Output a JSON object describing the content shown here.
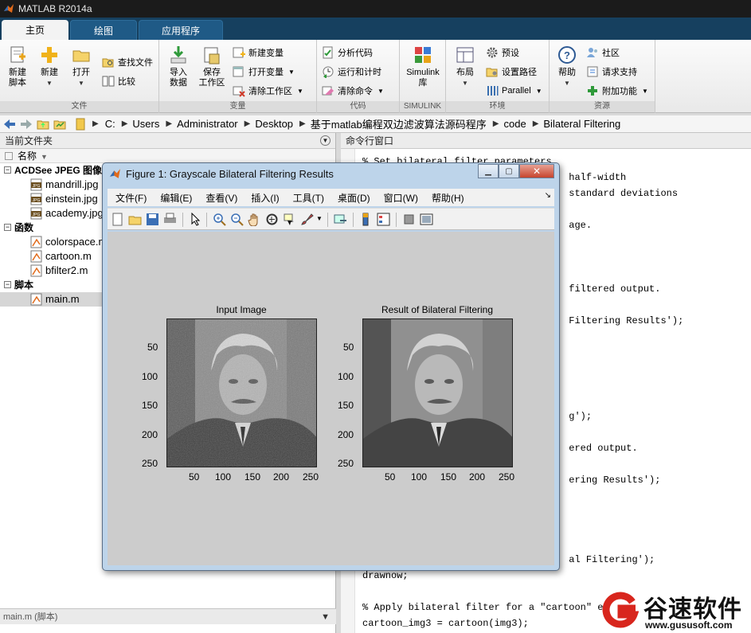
{
  "window": {
    "title": "MATLAB R2014a"
  },
  "tabs": [
    {
      "label": "主页",
      "active": true
    },
    {
      "label": "绘图",
      "active": false
    },
    {
      "label": "应用程序",
      "active": false
    }
  ],
  "ribbon": {
    "file_group": {
      "label": "文件",
      "new_script": "新建\n脚本",
      "new": "新建",
      "open": "打开",
      "find_files": "查找文件",
      "compare": "比较"
    },
    "variable_group": {
      "label": "变量",
      "import_data": "导入\n数据",
      "save_workspace": "保存\n工作区",
      "new_variable": "新建变量",
      "open_variable": "打开变量",
      "clear_workspace": "清除工作区"
    },
    "code_group": {
      "label": "代码",
      "analyze_code": "分析代码",
      "run_and_time": "运行和计时",
      "clear_commands": "清除命令"
    },
    "simulink_group": {
      "label": "SIMULINK",
      "library": "Simulink\n库"
    },
    "environment_group": {
      "label": "环境",
      "layout": "布局",
      "preferences": "预设",
      "set_path": "设置路径",
      "parallel": "Parallel"
    },
    "resources_group": {
      "label": "资源",
      "help": "帮助",
      "community": "社区",
      "request_support": "请求支持",
      "add_ons": "附加功能"
    }
  },
  "address": {
    "crumbs": [
      "C:",
      "Users",
      "Administrator",
      "Desktop",
      "基于matlab编程双边滤波算法源码程序",
      "code",
      "Bilateral Filtering"
    ]
  },
  "current_folder": {
    "title": "当前文件夹",
    "column_name": "名称",
    "groups": [
      {
        "label": "ACDSee JPEG 图像",
        "items": [
          "mandrill.jpg",
          "einstein.jpg",
          "academy.jpg"
        ]
      },
      {
        "label": "函数",
        "items": [
          "colorspace.m",
          "cartoon.m",
          "bfilter2.m"
        ]
      },
      {
        "label": "脚本",
        "items": [
          "main.m"
        ]
      }
    ],
    "details_label": "main.m (脚本)"
  },
  "command_window": {
    "title": "命令行窗口",
    "lines": [
      "% Set bilateral filter parameters.",
      "                                    half-width",
      "                                    standard deviations",
      "",
      "                                    age.",
      "",
      "",
      "",
      "                                    filtered output.",
      "",
      "                                    Filtering Results');",
      "",
      "",
      "",
      "",
      "",
      "                                    g');",
      "",
      "                                    ered output.",
      "",
      "                                    ering Results');",
      "",
      "",
      "",
      "",
      "                                    al Filtering');",
      "drawnow;",
      "",
      "% Apply bilateral filter for a \"cartoon\" ef",
      "cartoon_img3 = cartoon(img3);"
    ]
  },
  "figure": {
    "title": "Figure 1: Grayscale Bilateral Filtering Results",
    "menu": [
      "文件(F)",
      "编辑(E)",
      "查看(V)",
      "插入(I)",
      "工具(T)",
      "桌面(D)",
      "窗口(W)",
      "帮助(H)"
    ],
    "axes": [
      {
        "title": "Input Image",
        "xticks": [
          "50",
          "100",
          "150",
          "200",
          "250"
        ],
        "yticks": [
          "50",
          "100",
          "150",
          "200",
          "250"
        ]
      },
      {
        "title": "Result of Bilateral Filtering",
        "xticks": [
          "50",
          "100",
          "150",
          "200",
          "250"
        ],
        "yticks": [
          "50",
          "100",
          "150",
          "200",
          "250"
        ]
      }
    ]
  },
  "watermark": {
    "brand": "谷速软件",
    "url": "www.gususoft.com"
  },
  "colors": {
    "tabs_bg": "#16405f",
    "figure_frame": "#bdd4ea",
    "close_button": "#c6442d"
  }
}
